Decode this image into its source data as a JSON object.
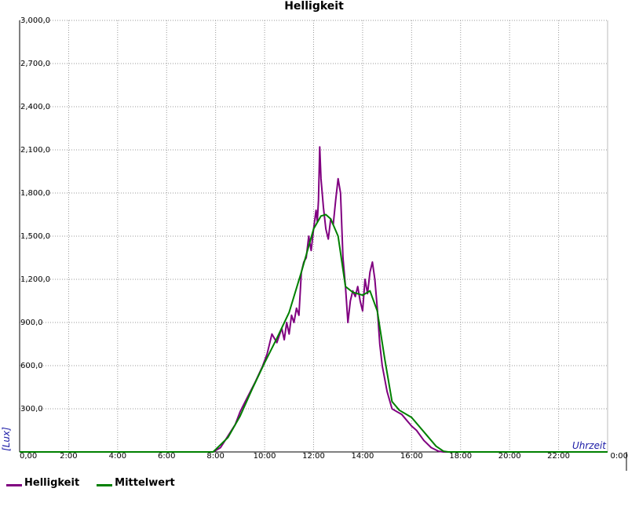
{
  "chart_data": {
    "type": "line",
    "title": "Helligkeit",
    "xlabel": "Uhrzeit",
    "ylabel": "[Lux]",
    "xlim": [
      0,
      24
    ],
    "ylim": [
      0,
      3000
    ],
    "x_ticks": [
      "0,00",
      "2:00",
      "4:00",
      "6:00",
      "8:00",
      "10:00",
      "12:00",
      "14:00",
      "16:00",
      "18:00",
      "20:00",
      "22:00",
      "0:00"
    ],
    "y_ticks": [
      "300,0",
      "600,0",
      "900,0",
      "1,200,0",
      "1,500,0",
      "1,800,0",
      "2,100,0",
      "2,400,0",
      "2,700,0",
      "3,000,0"
    ],
    "grid": true,
    "legend_position": "bottom-left",
    "series": [
      {
        "name": "Helligkeit",
        "color": "#800080",
        "x": [
          0,
          7.9,
          8.2,
          8.5,
          8.8,
          9.0,
          9.3,
          9.6,
          9.9,
          10.1,
          10.3,
          10.5,
          10.7,
          10.8,
          10.9,
          11.0,
          11.1,
          11.2,
          11.3,
          11.4,
          11.5,
          11.6,
          11.7,
          11.8,
          11.9,
          12.0,
          12.1,
          12.15,
          12.2,
          12.25,
          12.3,
          12.4,
          12.5,
          12.6,
          12.7,
          12.8,
          12.9,
          13.0,
          13.1,
          13.2,
          13.3,
          13.4,
          13.5,
          13.6,
          13.7,
          13.8,
          13.9,
          14.0,
          14.1,
          14.2,
          14.3,
          14.4,
          14.5,
          14.6,
          14.7,
          14.8,
          15.0,
          15.2,
          15.4,
          15.6,
          15.8,
          16.0,
          16.2,
          16.5,
          16.8,
          17.1,
          17.3,
          17.5,
          24
        ],
        "y": [
          0,
          0,
          30,
          110,
          190,
          280,
          380,
          480,
          590,
          680,
          820,
          760,
          860,
          780,
          900,
          820,
          950,
          900,
          1000,
          950,
          1250,
          1320,
          1350,
          1500,
          1400,
          1550,
          1680,
          1600,
          1750,
          2120,
          1900,
          1700,
          1550,
          1480,
          1620,
          1580,
          1750,
          1900,
          1800,
          1350,
          1150,
          900,
          1050,
          1120,
          1080,
          1150,
          1050,
          980,
          1200,
          1100,
          1250,
          1320,
          1200,
          1000,
          750,
          600,
          420,
          300,
          280,
          260,
          220,
          180,
          150,
          80,
          30,
          5,
          0,
          0,
          0
        ]
      },
      {
        "name": "Mittelwert",
        "color": "#008000",
        "x": [
          0,
          7.9,
          8.5,
          9.0,
          9.5,
          10.0,
          10.5,
          11.0,
          11.5,
          12.0,
          12.3,
          12.5,
          12.7,
          13.0,
          13.3,
          13.6,
          14.0,
          14.3,
          14.6,
          14.9,
          15.2,
          15.5,
          16.0,
          16.5,
          17.0,
          17.3,
          17.5,
          24
        ],
        "y": [
          0,
          0,
          100,
          250,
          440,
          620,
          790,
          970,
          1250,
          1550,
          1640,
          1650,
          1620,
          1500,
          1150,
          1110,
          1090,
          1120,
          980,
          650,
          350,
          290,
          240,
          140,
          40,
          5,
          0,
          0
        ]
      }
    ]
  }
}
